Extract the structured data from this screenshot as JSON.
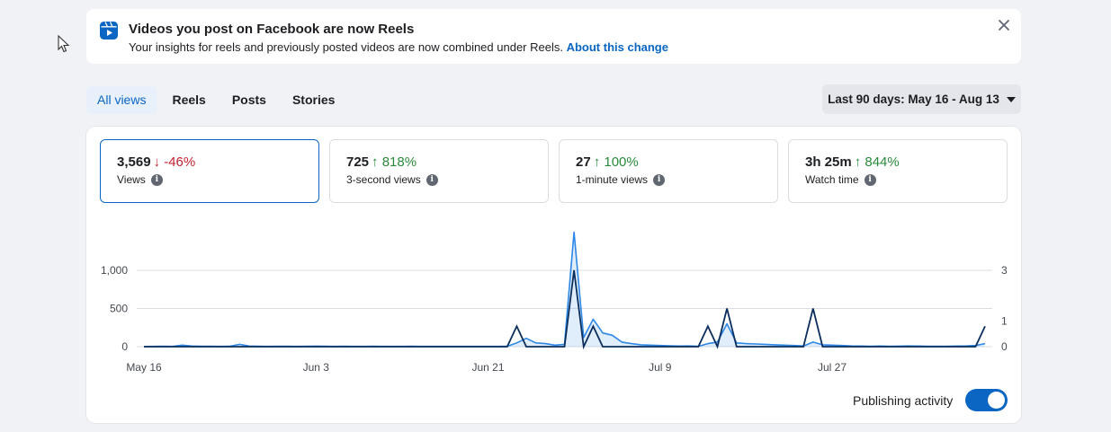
{
  "banner": {
    "title": "Videos you post on Facebook are now Reels",
    "description": "Your insights for reels and previously posted videos are now combined under Reels.",
    "link": "About this change"
  },
  "tabs": [
    {
      "label": "All views",
      "active": true
    },
    {
      "label": "Reels",
      "active": false
    },
    {
      "label": "Posts",
      "active": false
    },
    {
      "label": "Stories",
      "active": false
    }
  ],
  "date_range": "Last 90 days: May 16 - Aug 13",
  "metrics": [
    {
      "value": "3,569",
      "change": "-46%",
      "direction": "down",
      "label": "Views",
      "selected": true
    },
    {
      "value": "725",
      "change": "818%",
      "direction": "up",
      "label": "3-second views",
      "selected": false
    },
    {
      "value": "27",
      "change": "100%",
      "direction": "up",
      "label": "1-minute views",
      "selected": false
    },
    {
      "value": "3h 25m",
      "change": "844%",
      "direction": "up",
      "label": "Watch time",
      "selected": false
    }
  ],
  "publishing_activity": {
    "label": "Publishing activity",
    "enabled": true
  },
  "colors": {
    "accent": "#0a66c2",
    "views_line": "#2d88e6",
    "publishing_line": "#0b2e5c",
    "down": "#c22230",
    "up": "#2a8a3c"
  },
  "chart_data": {
    "type": "line",
    "x_tick_labels": [
      "May 16",
      "Jun 3",
      "Jun 21",
      "Jul 9",
      "Jul 27"
    ],
    "left_axis": {
      "ticks": [
        0,
        500,
        1000
      ],
      "range": [
        0,
        1000
      ]
    },
    "right_axis": {
      "ticks": [
        0,
        1,
        3
      ],
      "range": [
        0,
        3
      ]
    },
    "x_range_days": [
      0,
      88
    ],
    "series": [
      {
        "axis": "left",
        "points": [
          [
            0,
            2
          ],
          [
            1,
            3
          ],
          [
            2,
            5
          ],
          [
            3,
            4
          ],
          [
            4,
            20
          ],
          [
            5,
            8
          ],
          [
            6,
            5
          ],
          [
            7,
            5
          ],
          [
            8,
            4
          ],
          [
            9,
            6
          ],
          [
            10,
            30
          ],
          [
            11,
            8
          ],
          [
            12,
            5
          ],
          [
            13,
            4
          ],
          [
            14,
            5
          ],
          [
            15,
            6
          ],
          [
            16,
            4
          ],
          [
            17,
            5
          ],
          [
            18,
            7
          ],
          [
            19,
            5
          ],
          [
            20,
            4
          ],
          [
            21,
            5
          ],
          [
            22,
            4
          ],
          [
            23,
            3
          ],
          [
            24,
            5
          ],
          [
            25,
            4
          ],
          [
            26,
            3
          ],
          [
            27,
            4
          ],
          [
            28,
            5
          ],
          [
            29,
            3
          ],
          [
            30,
            4
          ],
          [
            31,
            3
          ],
          [
            32,
            4
          ],
          [
            33,
            3
          ],
          [
            34,
            4
          ],
          [
            35,
            3
          ],
          [
            36,
            4
          ],
          [
            37,
            3
          ],
          [
            38,
            5
          ],
          [
            39,
            50
          ],
          [
            40,
            110
          ],
          [
            41,
            50
          ],
          [
            42,
            40
          ],
          [
            43,
            20
          ],
          [
            44,
            30
          ],
          [
            45,
            1500
          ],
          [
            46,
            120
          ],
          [
            47,
            360
          ],
          [
            48,
            180
          ],
          [
            49,
            150
          ],
          [
            50,
            60
          ],
          [
            51,
            40
          ],
          [
            52,
            25
          ],
          [
            53,
            20
          ],
          [
            54,
            15
          ],
          [
            55,
            12
          ],
          [
            56,
            8
          ],
          [
            57,
            10
          ],
          [
            58,
            5
          ],
          [
            59,
            40
          ],
          [
            60,
            60
          ],
          [
            61,
            300
          ],
          [
            62,
            50
          ],
          [
            63,
            40
          ],
          [
            64,
            35
          ],
          [
            65,
            30
          ],
          [
            66,
            25
          ],
          [
            67,
            20
          ],
          [
            68,
            15
          ],
          [
            69,
            10
          ],
          [
            70,
            60
          ],
          [
            71,
            25
          ],
          [
            72,
            20
          ],
          [
            73,
            15
          ],
          [
            74,
            10
          ],
          [
            75,
            8
          ],
          [
            76,
            6
          ],
          [
            77,
            8
          ],
          [
            78,
            6
          ],
          [
            79,
            7
          ],
          [
            80,
            10
          ],
          [
            81,
            8
          ],
          [
            82,
            6
          ],
          [
            83,
            5
          ],
          [
            84,
            6
          ],
          [
            85,
            8
          ],
          [
            86,
            10
          ],
          [
            87,
            15
          ],
          [
            88,
            40
          ]
        ]
      },
      {
        "axis": "right",
        "points": [
          [
            0,
            0
          ],
          [
            38,
            0
          ],
          [
            39,
            0.8
          ],
          [
            40,
            0
          ],
          [
            44,
            0
          ],
          [
            45,
            3
          ],
          [
            46,
            0
          ],
          [
            47,
            0.8
          ],
          [
            48,
            0
          ],
          [
            58,
            0
          ],
          [
            59,
            0.8
          ],
          [
            60,
            0
          ],
          [
            61,
            1.5
          ],
          [
            62,
            0
          ],
          [
            69,
            0
          ],
          [
            70,
            1.5
          ],
          [
            71,
            0
          ],
          [
            87,
            0
          ],
          [
            88,
            0.8
          ]
        ]
      }
    ]
  }
}
